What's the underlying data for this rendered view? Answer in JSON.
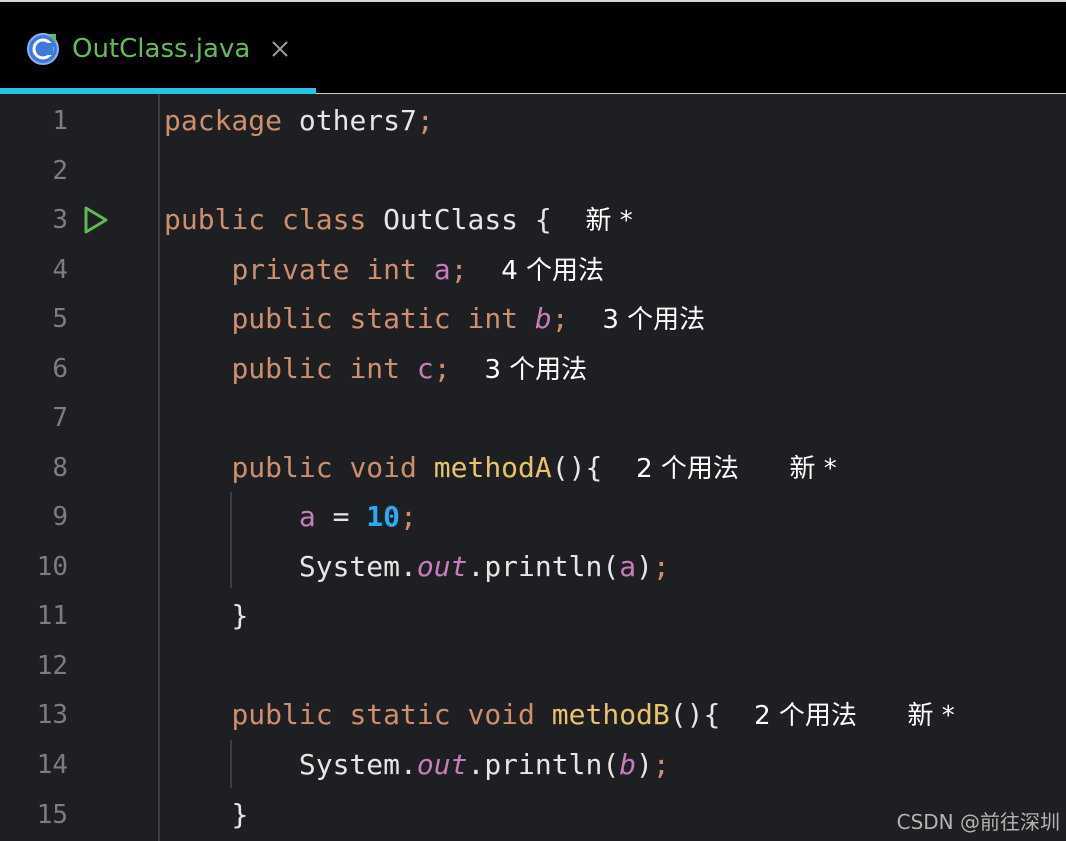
{
  "tab": {
    "title": "OutClass.java",
    "icon": "java-class-icon",
    "close_icon": "close-icon",
    "accent": "#24c8e6",
    "title_color": "#5fbf55"
  },
  "editor": {
    "lines": [
      {
        "n": "1"
      },
      {
        "n": "2"
      },
      {
        "n": "3"
      },
      {
        "n": "4"
      },
      {
        "n": "5"
      },
      {
        "n": "6"
      },
      {
        "n": "7"
      },
      {
        "n": "8"
      },
      {
        "n": "9"
      },
      {
        "n": "10"
      },
      {
        "n": "11"
      },
      {
        "n": "12"
      },
      {
        "n": "13"
      },
      {
        "n": "14"
      },
      {
        "n": "15"
      }
    ],
    "tokens": {
      "package_kw": "package",
      "package_name": "others7",
      "semi": ";",
      "public": "public",
      "class_kw": "class",
      "class_name": "OutClass",
      "open_brace": "{",
      "close_brace": "}",
      "private": "private",
      "int": "int",
      "static": "static",
      "void": "void",
      "field_a": "a",
      "field_b": "b",
      "field_c": "c",
      "methodA": "methodA",
      "methodB": "methodB",
      "parens_open_brace": "(){",
      "assign": " = ",
      "ten": "10",
      "system": "System",
      "dot": ".",
      "out": "out",
      "println": "println",
      "lparen": "(",
      "rparen": ")"
    },
    "hints": {
      "new_star": "新 *",
      "usages_4": "4 个用法",
      "usages_3": "3 个用法",
      "usages_2": "2 个用法"
    },
    "run_icon": "run-gutter-icon"
  },
  "watermark": "CSDN @前往深圳"
}
